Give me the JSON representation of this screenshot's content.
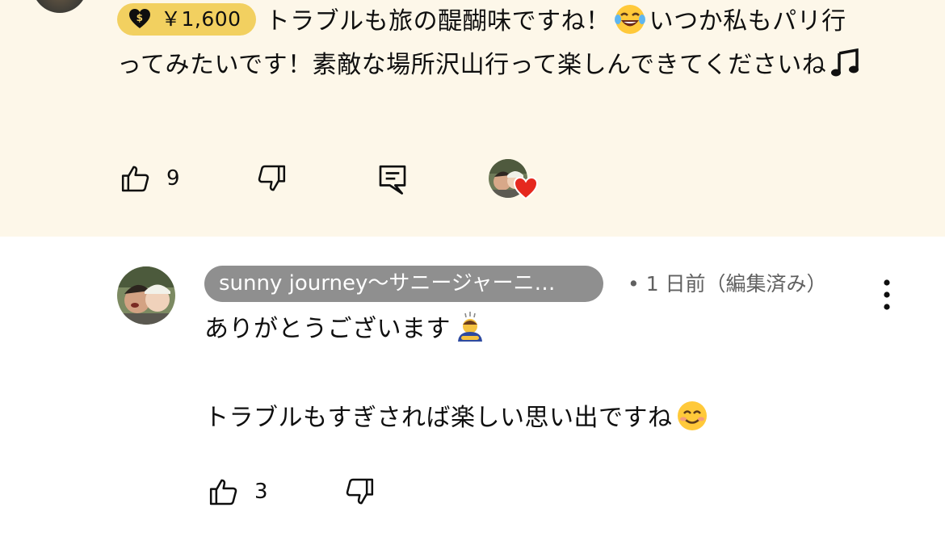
{
  "super_comment": {
    "chip_amount": "￥1,600",
    "text_part1": "トラブルも旅の醍醐味ですね！",
    "text_part2": "いつか私もパリ行ってみたいです！素敵な場所沢山行って楽しんできてくださいね",
    "emoji_1": "face-with-tears-of-joy-emoji",
    "emoji_2": "musical-notes-emoji",
    "like_count": "9",
    "chip_color": "#f2d060",
    "background_color": "#fdf7e9"
  },
  "reply": {
    "author": "sunny journey～サニージャーニ…",
    "meta": "• 1 日前（編集済み）",
    "line1": "ありがとうございます",
    "line1_emoji": "bowing-person-emoji",
    "line2": "トラブルもすぎされば楽しい思い出ですね",
    "line2_emoji": "smiling-face-emoji",
    "like_count": "3",
    "author_chip_color": "#8f8f8f"
  },
  "icons": {
    "like": "thumb-up-icon",
    "dislike": "thumb-down-icon",
    "reply": "comment-reply-icon",
    "creator_heart": "creator-heart-icon",
    "more": "kebab-menu-icon"
  }
}
